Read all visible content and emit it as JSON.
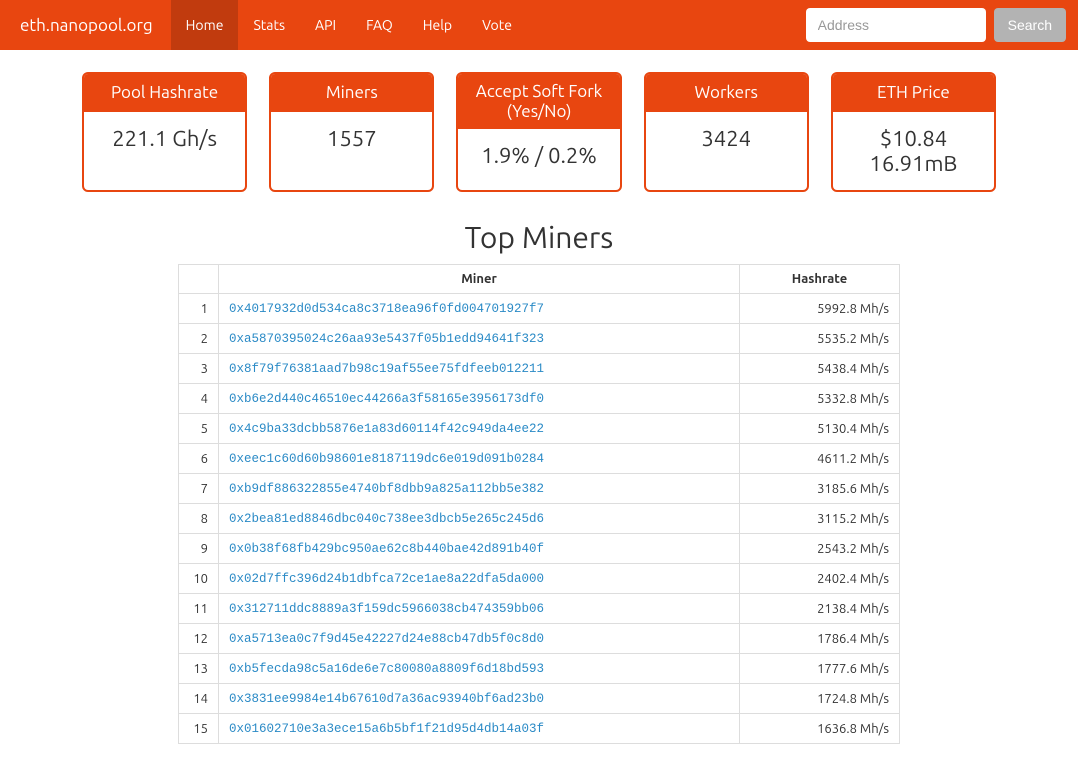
{
  "brand": "eth.nanopool.org",
  "nav": {
    "items": [
      {
        "label": "Home",
        "active": true
      },
      {
        "label": "Stats",
        "active": false
      },
      {
        "label": "API",
        "active": false
      },
      {
        "label": "FAQ",
        "active": false
      },
      {
        "label": "Help",
        "active": false
      },
      {
        "label": "Vote",
        "active": false
      }
    ],
    "search_placeholder": "Address",
    "search_button": "Search"
  },
  "stats": [
    {
      "label": "Pool Hashrate",
      "value": "221.1 Gh/s"
    },
    {
      "label": "Miners",
      "value": "1557"
    },
    {
      "label": "Accept Soft Fork (Yes/No)",
      "value": "1.9% / 0.2%"
    },
    {
      "label": "Workers",
      "value": "3424"
    },
    {
      "label": "ETH Price",
      "value": "$10.84 16.91mB"
    }
  ],
  "section_title": "Top Miners",
  "table": {
    "headers": {
      "rank": "",
      "miner": "Miner",
      "hashrate": "Hashrate"
    },
    "rows": [
      {
        "rank": "1",
        "miner": "0x4017932d0d534ca8c3718ea96f0fd004701927f7",
        "hashrate": "5992.8 Mh/s"
      },
      {
        "rank": "2",
        "miner": "0xa5870395024c26aa93e5437f05b1edd94641f323",
        "hashrate": "5535.2 Mh/s"
      },
      {
        "rank": "3",
        "miner": "0x8f79f76381aad7b98c19af55ee75fdfeeb012211",
        "hashrate": "5438.4 Mh/s"
      },
      {
        "rank": "4",
        "miner": "0xb6e2d440c46510ec44266a3f58165e3956173df0",
        "hashrate": "5332.8 Mh/s"
      },
      {
        "rank": "5",
        "miner": "0x4c9ba33dcbb5876e1a83d60114f42c949da4ee22",
        "hashrate": "5130.4 Mh/s"
      },
      {
        "rank": "6",
        "miner": "0xeec1c60d60b98601e8187119dc6e019d091b0284",
        "hashrate": "4611.2 Mh/s"
      },
      {
        "rank": "7",
        "miner": "0xb9df886322855e4740bf8dbb9a825a112bb5e382",
        "hashrate": "3185.6 Mh/s"
      },
      {
        "rank": "8",
        "miner": "0x2bea81ed8846dbc040c738ee3dbcb5e265c245d6",
        "hashrate": "3115.2 Mh/s"
      },
      {
        "rank": "9",
        "miner": "0x0b38f68fb429bc950ae62c8b440bae42d891b40f",
        "hashrate": "2543.2 Mh/s"
      },
      {
        "rank": "10",
        "miner": "0x02d7ffc396d24b1dbfca72ce1ae8a22dfa5da000",
        "hashrate": "2402.4 Mh/s"
      },
      {
        "rank": "11",
        "miner": "0x312711ddc8889a3f159dc5966038cb474359bb06",
        "hashrate": "2138.4 Mh/s"
      },
      {
        "rank": "12",
        "miner": "0xa5713ea0c7f9d45e42227d24e88cb47db5f0c8d0",
        "hashrate": "1786.4 Mh/s"
      },
      {
        "rank": "13",
        "miner": "0xb5fecda98c5a16de6e7c80080a8809f6d18bd593",
        "hashrate": "1777.6 Mh/s"
      },
      {
        "rank": "14",
        "miner": "0x3831ee9984e14b67610d7a36ac93940bf6ad23b0",
        "hashrate": "1724.8 Mh/s"
      },
      {
        "rank": "15",
        "miner": "0x01602710e3a3ece15a6b5bf1f21d95d4db14a03f",
        "hashrate": "1636.8 Mh/s"
      }
    ]
  }
}
